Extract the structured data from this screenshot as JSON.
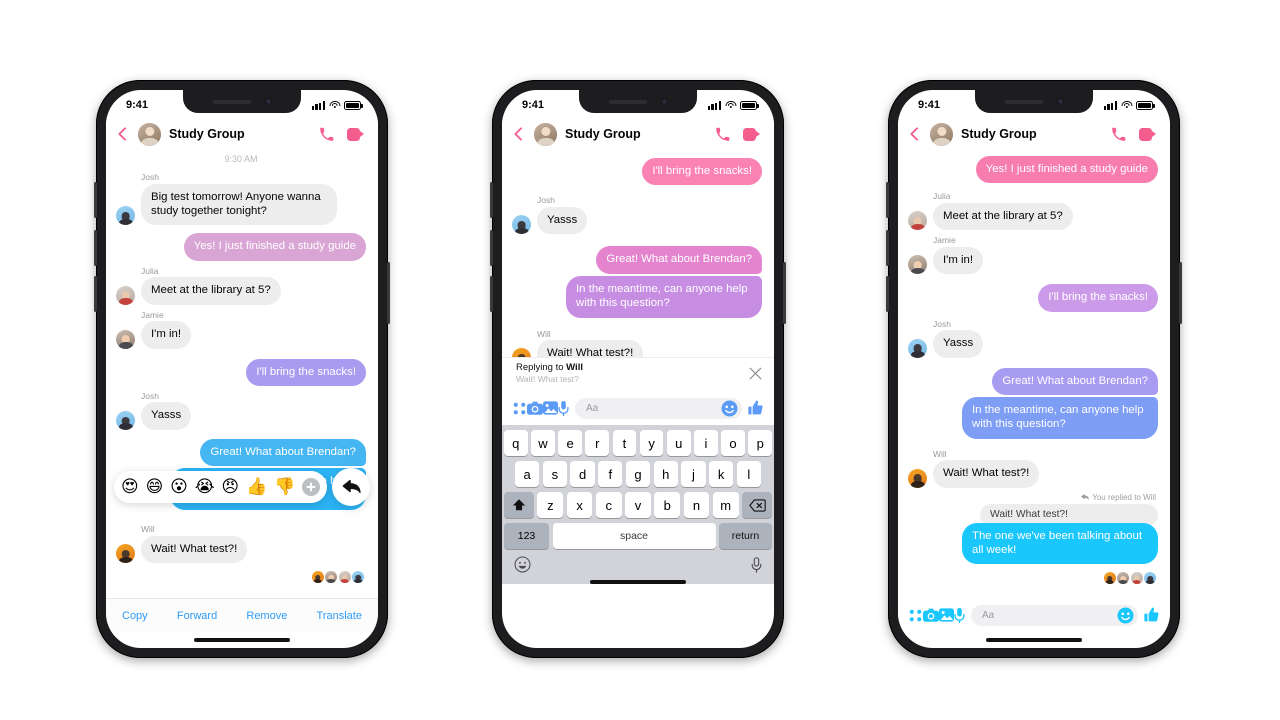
{
  "status_bar": {
    "time": "9:41"
  },
  "header": {
    "title": "Study Group",
    "back_icon": "chevron-left-icon",
    "call_icon": "phone-icon",
    "video_icon": "video-camera-icon"
  },
  "colors": {
    "accent_pink": "#F35E8E",
    "action_blue": "#2E9BF5",
    "composer_blue": "#5B9BF5",
    "composer_cyan": "#1AC7FC",
    "incoming_bubble": "#EDEDED"
  },
  "phone1": {
    "daystamp": "9:30 AM",
    "messages": [
      {
        "sender": "Josh",
        "text": "Big test tomorrow! Anyone wanna study together tonight?",
        "dir": "in"
      },
      {
        "sender": "",
        "text": "Yes! I just finished a study guide",
        "dir": "out"
      },
      {
        "sender": "Julia",
        "text": "Meet at the library at 5?",
        "dir": "in"
      },
      {
        "sender": "Jamie",
        "text": "I'm in!",
        "dir": "in"
      },
      {
        "sender": "",
        "text": "I'll bring the snacks!",
        "dir": "out"
      },
      {
        "sender": "Josh",
        "text": "Yasss",
        "dir": "in"
      },
      {
        "sender": "",
        "text": "Great! What about Brendan?",
        "dir": "out"
      },
      {
        "sender": "",
        "text": "In the meantime, can anyone help with this question?",
        "dir": "out"
      },
      {
        "sender": "Will",
        "text": "Wait! What test?!",
        "dir": "in"
      }
    ],
    "reactions": [
      "😍",
      "😄",
      "😮",
      "😭",
      "😠",
      "👍",
      "👎"
    ],
    "reaction_add_label": "+",
    "reply_icon": "reply-arrow-icon",
    "action_menu": [
      "Copy",
      "Forward",
      "Remove",
      "Translate"
    ]
  },
  "phone2": {
    "messages": [
      {
        "sender": "",
        "text": "I'll bring the snacks!",
        "dir": "out"
      },
      {
        "sender": "Josh",
        "text": "Yasss",
        "dir": "in"
      },
      {
        "sender": "",
        "text": "Great! What about Brendan?",
        "dir": "out"
      },
      {
        "sender": "",
        "text": "In the meantime, can anyone help with this question?",
        "dir": "out"
      },
      {
        "sender": "Will",
        "text": "Wait! What test?!",
        "dir": "in"
      }
    ],
    "reply_panel": {
      "prefix": "Replying to",
      "target": "Will",
      "quote": "Wait! What test?",
      "close_icon": "close-x-icon"
    },
    "composer": {
      "more_icon": "four-dots-icon",
      "camera_icon": "camera-icon",
      "gallery_icon": "photo-icon",
      "mic_icon": "microphone-icon",
      "input_placeholder": "Aa",
      "sticker_icon": "smiley-icon",
      "like_icon": "thumbs-up-icon"
    },
    "keyboard": {
      "row1": [
        "q",
        "w",
        "e",
        "r",
        "t",
        "y",
        "u",
        "i",
        "o",
        "p"
      ],
      "row2": [
        "a",
        "s",
        "d",
        "f",
        "g",
        "h",
        "j",
        "k",
        "l"
      ],
      "row3": [
        "z",
        "x",
        "c",
        "v",
        "b",
        "n",
        "m"
      ],
      "shift_icon": "shift-arrow-icon",
      "backspace_icon": "backspace-icon",
      "numbers_key": "123",
      "space_key": "space",
      "return_key": "return",
      "emoji_icon": "emoji-keyboard-icon",
      "dictation_icon": "dictation-mic-icon"
    }
  },
  "phone3": {
    "messages": [
      {
        "sender": "",
        "text": "Yes! I just finished a study guide",
        "dir": "out"
      },
      {
        "sender": "Julia",
        "text": "Meet at the library at 5?",
        "dir": "in"
      },
      {
        "sender": "Jamie",
        "text": "I'm in!",
        "dir": "in"
      },
      {
        "sender": "",
        "text": "I'll bring the snacks!",
        "dir": "out"
      },
      {
        "sender": "Josh",
        "text": "Yasss",
        "dir": "in"
      },
      {
        "sender": "",
        "text": "Great! What about Brendan?",
        "dir": "out"
      },
      {
        "sender": "",
        "text": "In the meantime, can anyone help with this question?",
        "dir": "out"
      },
      {
        "sender": "Will",
        "text": "Wait! What test?!",
        "dir": "in"
      }
    ],
    "reply_thread": {
      "label": "You replied to Will",
      "quote": "Wait! What test?!",
      "response": "The one we've been talking about all week!"
    },
    "composer": {
      "more_icon": "four-dots-icon",
      "camera_icon": "camera-icon",
      "gallery_icon": "photo-icon",
      "mic_icon": "microphone-icon",
      "input_placeholder": "Aa",
      "sticker_icon": "smiley-icon",
      "like_icon": "thumbs-up-icon"
    }
  }
}
